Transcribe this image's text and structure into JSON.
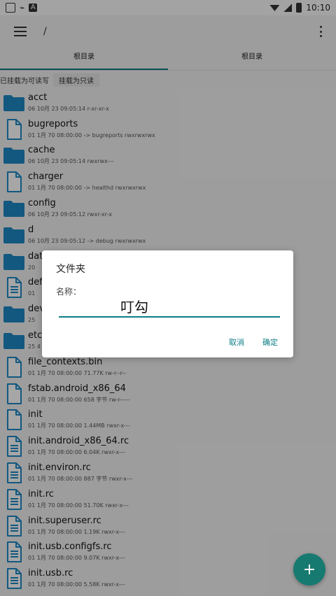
{
  "status": {
    "time": "10:10"
  },
  "appbar": {
    "path": "/"
  },
  "tabs": [
    {
      "label": "根目录"
    },
    {
      "label": "根目录"
    }
  ],
  "mount": {
    "status": "已挂载为可读写",
    "button": "挂载为只读"
  },
  "files": [
    {
      "name": "acct",
      "meta": "06 10月 23 09:05:14   r-xr-xr-x",
      "icon": "folder-icon"
    },
    {
      "name": "bugreports",
      "meta": "01 1月 70 08:00:00  -> bugreports  rwxrwxrwx",
      "icon": "file-icon"
    },
    {
      "name": "cache",
      "meta": "06 10月 23 09:05:14   rwxrwx---",
      "icon": "folder-icon"
    },
    {
      "name": "charger",
      "meta": "01 1月 70 08:00:00  -> healthd  rwxrwxrwx",
      "icon": "file-icon"
    },
    {
      "name": "config",
      "meta": "06 10月 23 09:05:12   rwxr-xr-x",
      "icon": "folder-icon"
    },
    {
      "name": "d",
      "meta": "06 10月 23 09:05:12  -> debug  rwxrwxrwx",
      "icon": "folder-icon"
    },
    {
      "name": "dat",
      "meta": "20",
      "icon": "folder-icon"
    },
    {
      "name": "def",
      "meta": "01",
      "icon": "document-icon"
    },
    {
      "name": "dev",
      "meta": "25",
      "icon": "folder-icon"
    },
    {
      "name": "etc",
      "meta": "25 4",
      "icon": "folder-icon"
    },
    {
      "name": "file_contexts.bin",
      "meta": "01 1月 70 08:00:00  71.77K  rw-r--r--",
      "icon": "file-icon"
    },
    {
      "name": "fstab.android_x86_64",
      "meta": "01 1月 70 08:00:00  658 字节  rw-r-----",
      "icon": "file-icon"
    },
    {
      "name": "init",
      "meta": "01 1月 70 08:00:00  1.44MB  rwxr-x---",
      "icon": "file-icon"
    },
    {
      "name": "init.android_x86_64.rc",
      "meta": "01 1月 70 08:00:00  6.04K  rwxr-x---",
      "icon": "document-icon"
    },
    {
      "name": "init.environ.rc",
      "meta": "01 1月 70 08:00:00  887 字节  rwxr-x---",
      "icon": "document-icon"
    },
    {
      "name": "init.rc",
      "meta": "01 1月 70 08:00:00  51.70K  rwxr-x---",
      "icon": "document-icon"
    },
    {
      "name": "init.superuser.rc",
      "meta": "01 1月 70 08:00:00  1.19K  rwxr-x---",
      "icon": "document-icon"
    },
    {
      "name": "init.usb.configfs.rc",
      "meta": "01 1月 70 08:00:00  9.07K  rwxr-x---",
      "icon": "document-icon"
    },
    {
      "name": "init.usb.rc",
      "meta": "01 1月 70 08:00:00  5.58K  rwxr-x---",
      "icon": "document-icon"
    }
  ],
  "dialog": {
    "title": "文件夹",
    "label": "名称：",
    "value": "叮勾",
    "cancel": "取消",
    "confirm": "确定"
  },
  "fab": {
    "icon": "+"
  },
  "colors": {
    "folder": "#1e88c4",
    "accent": "#0b7d86",
    "fab": "#177a70"
  }
}
